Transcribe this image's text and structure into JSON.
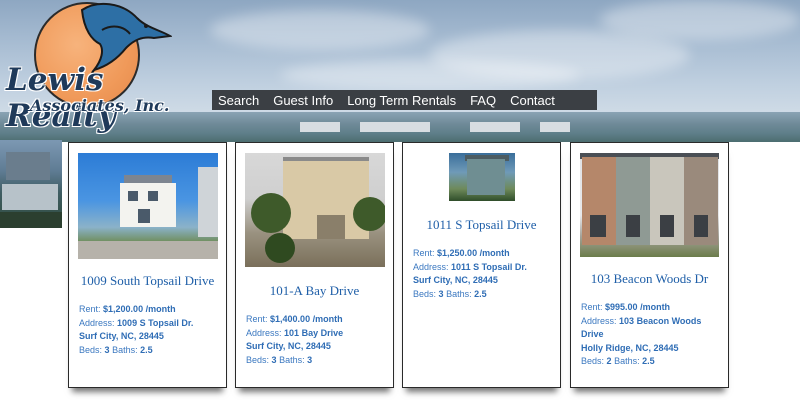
{
  "brand": {
    "name_line1": "Lewis Realty",
    "name_line2": "Associates, Inc."
  },
  "nav": {
    "items": [
      "Search",
      "Guest Info",
      "Long Term Rentals",
      "FAQ",
      "Contact"
    ]
  },
  "listings": [
    {
      "title": "1009 South Topsail Drive",
      "rent_label": "Rent:",
      "rent": "$1,200.00 /month",
      "address_label": "Address:",
      "address_line1": "1009 S Topsail Dr.",
      "address_line2": "Surf City, NC, 28445",
      "beds_label": "Beds:",
      "beds": "3",
      "baths_label": "Baths:",
      "baths": "2.5"
    },
    {
      "title": "101-A Bay Drive",
      "rent_label": "Rent:",
      "rent": "$1,400.00 /month",
      "address_label": "Address:",
      "address_line1": "101 Bay Drive",
      "address_line2": "Surf City, NC, 28445",
      "beds_label": "Beds:",
      "beds": "3",
      "baths_label": "Baths:",
      "baths": "3"
    },
    {
      "title": "1011 S Topsail Drive",
      "rent_label": "Rent:",
      "rent": "$1,250.00 /month",
      "address_label": "Address:",
      "address_line1": "1011 S Topsail Dr.",
      "address_line2": "Surf City, NC, 28445",
      "beds_label": "Beds:",
      "beds": "3",
      "baths_label": "Baths:",
      "baths": "2.5"
    },
    {
      "title": "103 Beacon Woods Dr",
      "rent_label": "Rent:",
      "rent": "$995.00 /month",
      "address_label": "Address:",
      "address_line1": "103 Beacon Woods Drive",
      "address_line2": "Holly Ridge, NC, 28445",
      "beds_label": "Beds:",
      "beds": "2",
      "baths_label": "Baths:",
      "baths": "2.5"
    }
  ],
  "colors": {
    "link_blue": "#1f5fa8",
    "nav_bg": "#3b3f44",
    "logo_sun": "#f09a5a",
    "logo_text": "#1f3a5a"
  }
}
